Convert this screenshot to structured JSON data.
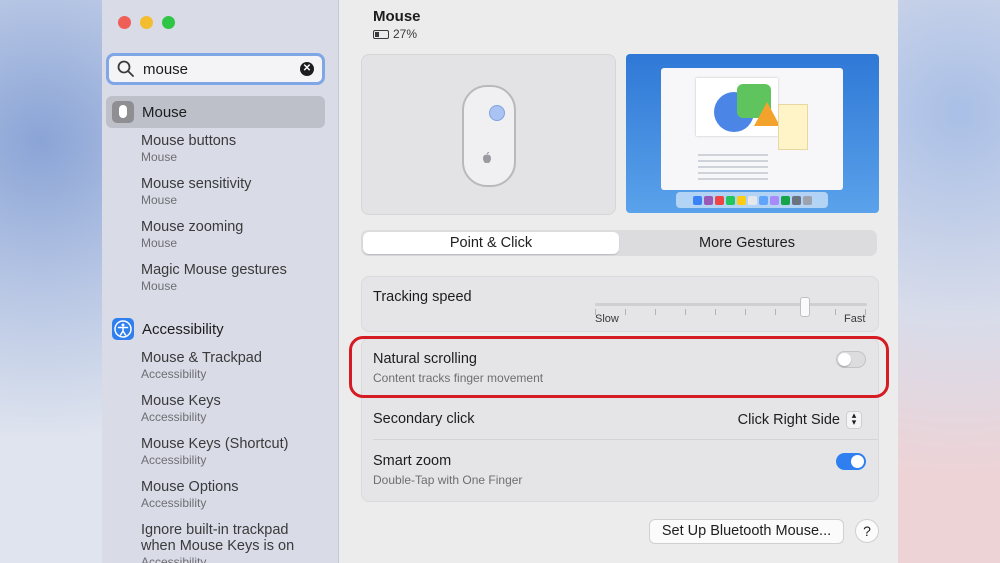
{
  "search": {
    "query": "mouse",
    "clear_icon": "close-circle-icon"
  },
  "sidebar": {
    "mouse_section": {
      "label": "Mouse",
      "icon": "mouse-icon",
      "results": [
        {
          "title": "Mouse buttons",
          "subtitle": "Mouse"
        },
        {
          "title": "Mouse sensitivity",
          "subtitle": "Mouse"
        },
        {
          "title": "Mouse zooming",
          "subtitle": "Mouse"
        },
        {
          "title": "Magic Mouse gestures",
          "subtitle": "Mouse"
        }
      ]
    },
    "accessibility_section": {
      "label": "Accessibility",
      "icon": "accessibility-icon",
      "results": [
        {
          "title": "Mouse & Trackpad",
          "subtitle": "Accessibility"
        },
        {
          "title": "Mouse Keys",
          "subtitle": "Accessibility"
        },
        {
          "title": "Mouse Keys (Shortcut)",
          "subtitle": "Accessibility"
        },
        {
          "title": "Mouse Options",
          "subtitle": "Accessibility"
        },
        {
          "title": "Ignore built-in trackpad",
          "title2": "when Mouse Keys is on",
          "subtitle": "Accessibility"
        }
      ]
    }
  },
  "main": {
    "title": "Mouse",
    "battery": "27%",
    "tabs": [
      {
        "label": "Point & Click",
        "selected": true
      },
      {
        "label": "More Gestures",
        "selected": false
      }
    ],
    "tracking": {
      "label": "Tracking speed",
      "min_label": "Slow",
      "max_label": "Fast",
      "value_fraction": 0.77
    },
    "natural_scrolling": {
      "label": "Natural scrolling",
      "subtitle": "Content tracks finger movement",
      "enabled": false
    },
    "secondary_click": {
      "label": "Secondary click",
      "value": "Click Right Side"
    },
    "smart_zoom": {
      "label": "Smart zoom",
      "subtitle": "Double-Tap with One Finger",
      "enabled": true
    },
    "bluetooth_button": "Set Up Bluetooth Mouse...",
    "help_button": "?"
  },
  "colors": {
    "accent": "#2f7ff0",
    "highlight": "#d51c22"
  }
}
